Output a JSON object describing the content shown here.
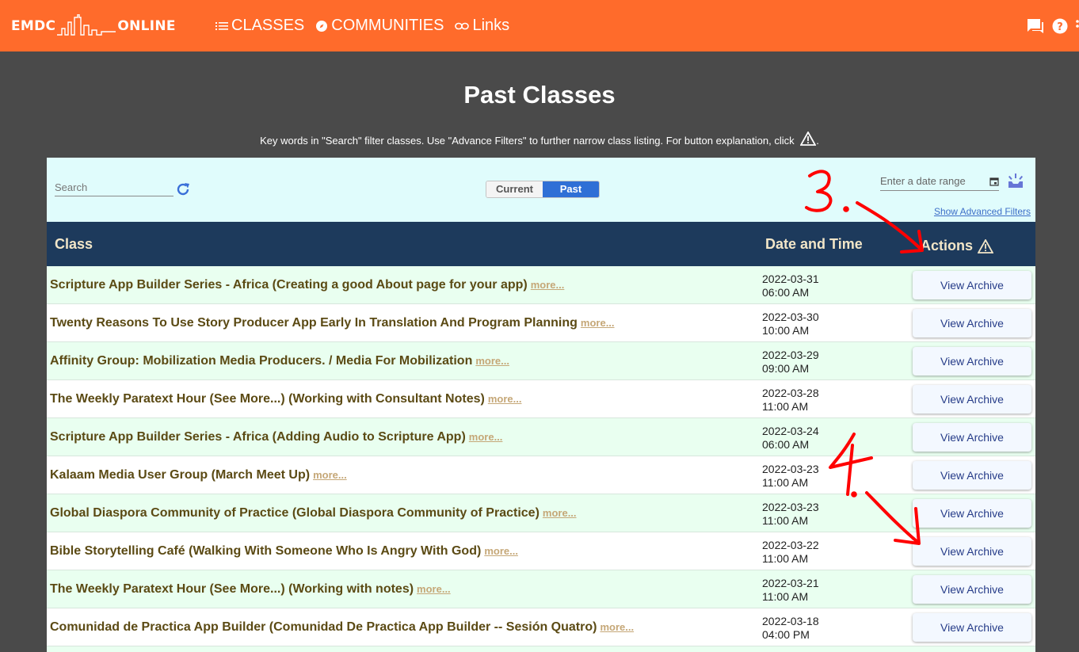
{
  "brand": {
    "left": "EMDC",
    "right": "ONLINE"
  },
  "nav": [
    {
      "label": "CLASSES",
      "icon": "list-icon"
    },
    {
      "label": "COMMUNITIES",
      "icon": "compass-icon"
    },
    {
      "label": "Links",
      "icon": "link-icon"
    }
  ],
  "top_icons": [
    "chat-icon",
    "help-icon"
  ],
  "page": {
    "title": "Past Classes",
    "hint": "Key words in \"Search\" filter classes. Use \"Advance Filters\" to further narrow class listing. For button explanation, click",
    "hint_end": "."
  },
  "filters": {
    "search_placeholder": "Search",
    "toggle_current": "Current",
    "toggle_past": "Past",
    "toggle_selected": "Past",
    "date_placeholder": "Enter a date range",
    "advanced_link": "Show Advanced Filters"
  },
  "table": {
    "col_class": "Class",
    "col_date": "Date and Time",
    "col_actions": "Actions",
    "more_label": "more...",
    "rows": [
      {
        "title": "Scripture App Builder Series - Africa (Creating a good About page for your app)",
        "date": "2022-03-31",
        "time": "06:00 AM",
        "action": "View Archive"
      },
      {
        "title": "Twenty Reasons To Use Story Producer App Early In Translation And Program Planning",
        "date": "2022-03-30",
        "time": "10:00 AM",
        "action": "View Archive"
      },
      {
        "title": "Affinity Group: Mobilization Media Producers. / Media For Mobilization",
        "date": "2022-03-29",
        "time": "09:00 AM",
        "action": "View Archive"
      },
      {
        "title": "The Weekly Paratext Hour (See More...) (Working with Consultant Notes)",
        "date": "2022-03-28",
        "time": "11:00 AM",
        "action": "View Archive"
      },
      {
        "title": "Scripture App Builder Series - Africa (Adding Audio to Scripture App)",
        "date": "2022-03-24",
        "time": "06:00 AM",
        "action": "View Archive"
      },
      {
        "title": "Kalaam Media User Group (March Meet Up)",
        "date": "2022-03-23",
        "time": "11:00 AM",
        "action": "View Archive"
      },
      {
        "title": "Global Diaspora Community of Practice (Global Diaspora Community of Practice)",
        "date": "2022-03-23",
        "time": "11:00 AM",
        "action": "View Archive"
      },
      {
        "title": "Bible Storytelling Café (Walking With Someone Who Is Angry With God)",
        "date": "2022-03-22",
        "time": "11:00 AM",
        "action": "View Archive"
      },
      {
        "title": "The Weekly Paratext Hour (See More...) (Working with notes)",
        "date": "2022-03-21",
        "time": "11:00 AM",
        "action": "View Archive"
      },
      {
        "title": "Comunidad de Practica App Builder (Comunidad De Practica App Builder -- Sesión Quatro)",
        "date": "2022-03-18",
        "time": "04:00 PM",
        "action": "View Archive"
      }
    ]
  },
  "annotations": {
    "step3": "3.",
    "step4": "4."
  },
  "colors": {
    "topbar": "#ff6b2b",
    "background": "#4a4a4a",
    "table_header": "#1d3a5c",
    "row_even": "#e9fff0",
    "row_odd": "#ffffff",
    "annotation": "#ff0000"
  }
}
